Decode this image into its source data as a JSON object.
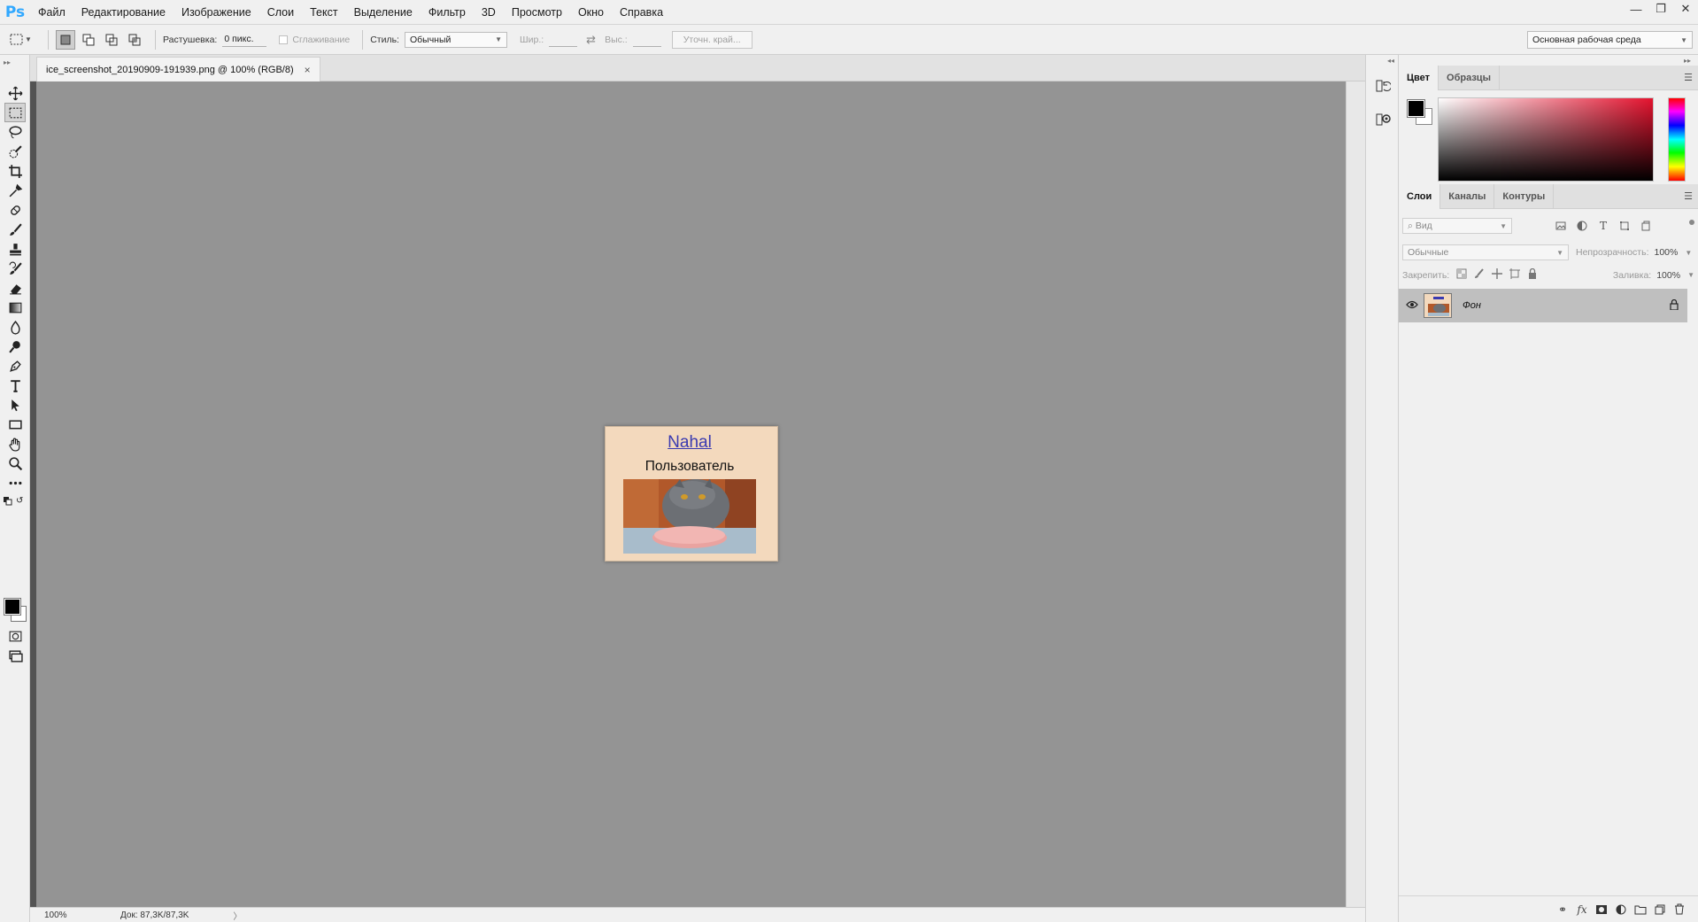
{
  "app": {
    "logo": "Ps"
  },
  "menu": [
    "Файл",
    "Редактирование",
    "Изображение",
    "Слои",
    "Текст",
    "Выделение",
    "Фильтр",
    "3D",
    "Просмотр",
    "Окно",
    "Справка"
  ],
  "options": {
    "feather_label": "Растушевка:",
    "feather_value": "0 пикс.",
    "antialias_label": "Сглаживание",
    "style_label": "Стиль:",
    "style_value": "Обычный",
    "width_label": "Шир.:",
    "height_label": "Выс.:",
    "refine_button": "Уточн. край...",
    "workspace": "Основная рабочая среда"
  },
  "document": {
    "tab_title": "ice_screenshot_20190909-191939.png @ 100% (RGB/8)",
    "close": "×",
    "image_link": "Nahal",
    "image_subtitle": "Пользователь"
  },
  "status": {
    "zoom": "100%",
    "doc_info": "Док: 87,3K/87,3K",
    "arrow": "〉"
  },
  "color_panel": {
    "tabs": [
      "Цвет",
      "Образцы"
    ],
    "foreground": "#000000",
    "background": "#ffffff"
  },
  "layers_panel": {
    "tabs": [
      "Слои",
      "Каналы",
      "Контуры"
    ],
    "filter_placeholder": "Вид",
    "blend_mode": "Обычные",
    "opacity_label": "Непрозрачность:",
    "opacity_value": "100%",
    "lock_label": "Закрепить:",
    "fill_label": "Заливка:",
    "fill_value": "100%",
    "layers": [
      {
        "name": "Фон",
        "visible": true,
        "locked": true
      }
    ]
  },
  "colors": {
    "accent": "#31a8ff",
    "canvas_bg": "#949494",
    "panel_bg": "#f0f0f0"
  }
}
